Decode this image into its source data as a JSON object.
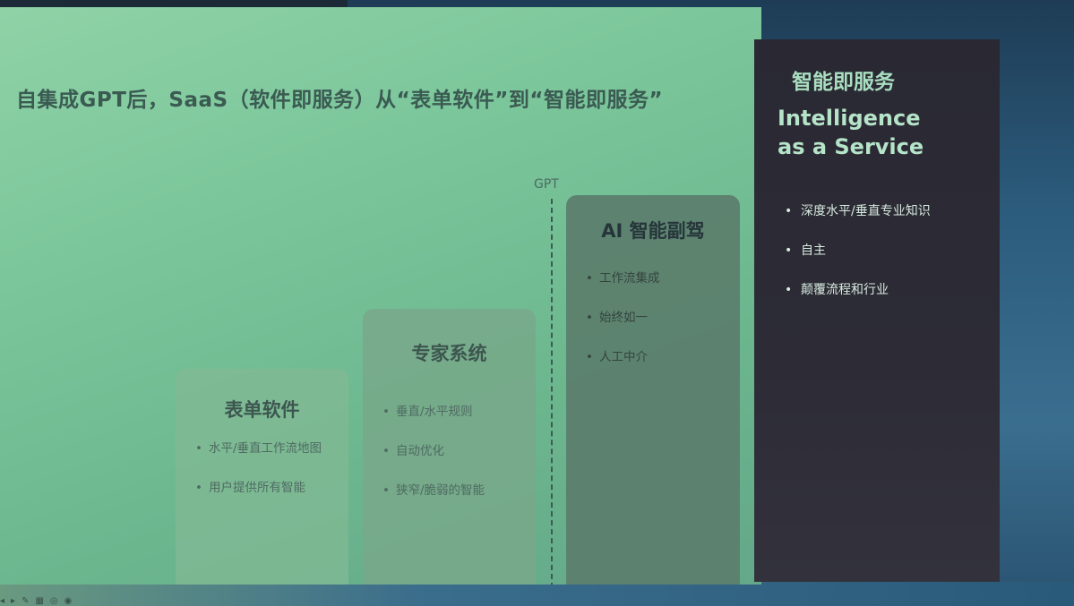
{
  "title": "自集成GPT后，SaaS（软件即服务）从“表单软件”到“智能即服务”",
  "gpt_label": "GPT",
  "stages": [
    {
      "title": "表单软件",
      "bullets": [
        "水平/垂直工作流地图",
        "用户提供所有智能"
      ]
    },
    {
      "title": "专家系统",
      "bullets": [
        "垂直/水平规则",
        "自动优化",
        "狭窄/脆弱的智能"
      ]
    },
    {
      "title": "AI 智能副驾",
      "bullets": [
        "工作流集成",
        "始终如一",
        "人工中介"
      ]
    }
  ],
  "iaas": {
    "title_cn": "智能即服务",
    "title_en_line1": "Intelligence",
    "title_en_line2": "as a Service",
    "bullets": [
      "深度水平/垂直专业知识",
      "自主",
      "颠覆流程和行业"
    ]
  },
  "bullet_glyph": "•",
  "toolbar_icons": [
    "prev-icon",
    "next-icon",
    "pen-icon",
    "grid-icon",
    "zoom-icon",
    "more-icon"
  ],
  "colors": {
    "slide_green": "#7dc79c",
    "panel_dark": "#2d2c36",
    "accent_mint": "#b5e4c9"
  }
}
